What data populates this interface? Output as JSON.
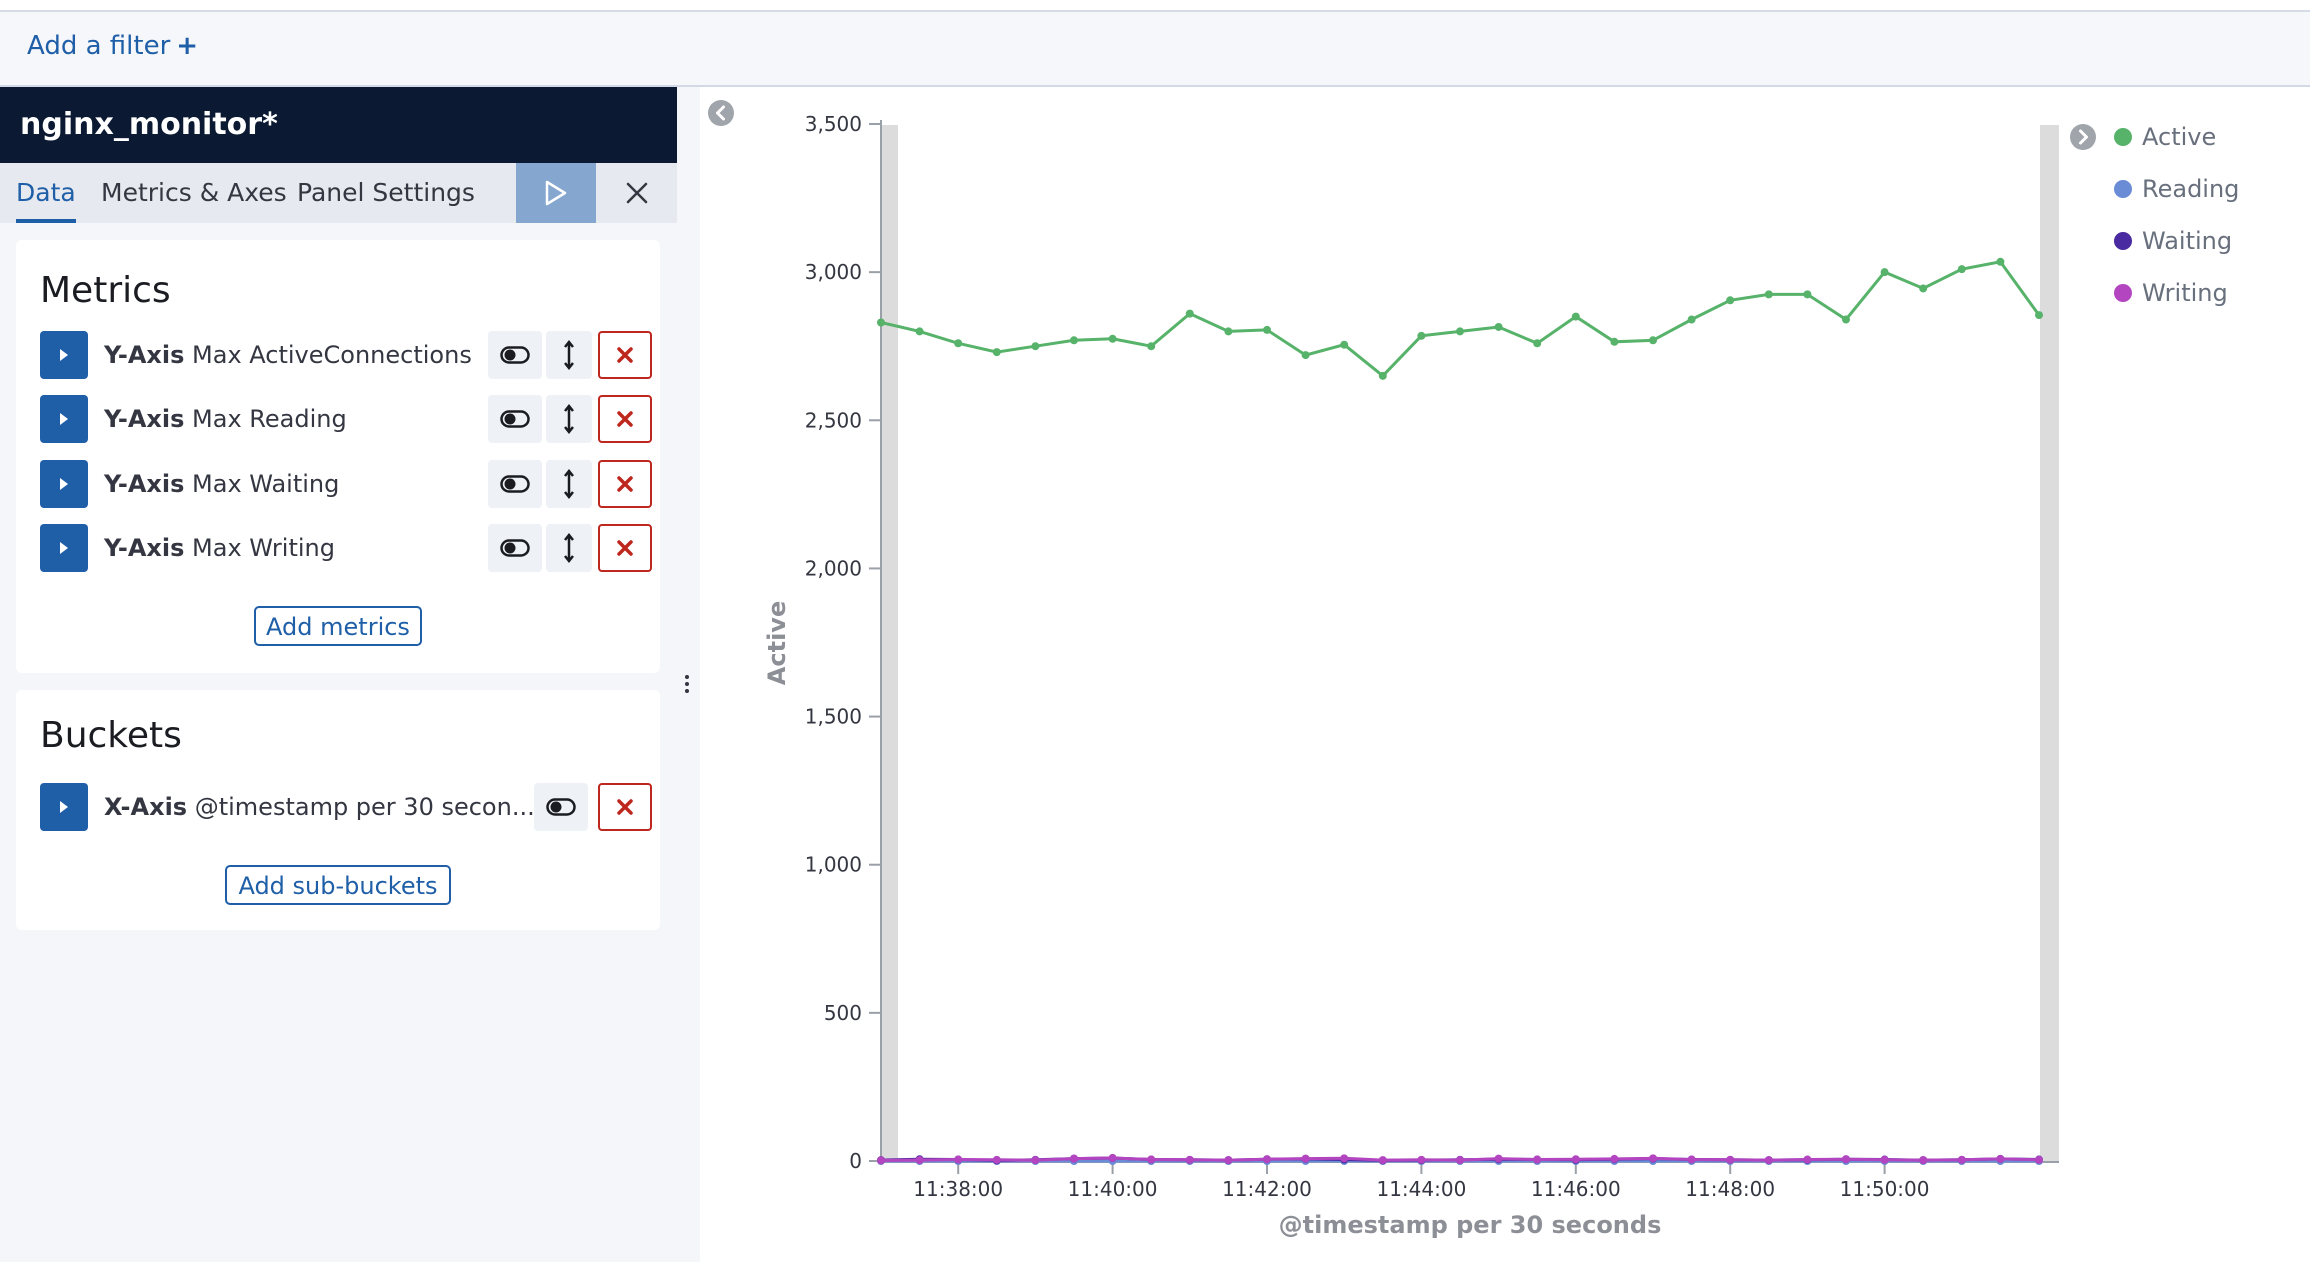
{
  "filter_bar": {
    "add_filter_label": "Add a filter",
    "plus_icon": "+"
  },
  "sidebar": {
    "title": "nginx_monitor*",
    "tabs": [
      {
        "label": "Data"
      },
      {
        "label": "Metrics & Axes"
      },
      {
        "label": "Panel Settings"
      }
    ],
    "metrics": {
      "heading": "Metrics",
      "items": [
        {
          "axis": "Y-Axis",
          "label": "Max ActiveConnections"
        },
        {
          "axis": "Y-Axis",
          "label": "Max Reading"
        },
        {
          "axis": "Y-Axis",
          "label": "Max Waiting"
        },
        {
          "axis": "Y-Axis",
          "label": "Max Writing"
        }
      ],
      "add_label": "Add metrics"
    },
    "buckets": {
      "heading": "Buckets",
      "items": [
        {
          "axis": "X-Axis",
          "label": "@timestamp per 30 secon..."
        }
      ],
      "add_label": "Add sub-buckets"
    }
  },
  "legend": [
    {
      "label": "Active",
      "color": "#57b26a"
    },
    {
      "label": "Reading",
      "color": "#6a8bd6"
    },
    {
      "label": "Waiting",
      "color": "#4a2aa0"
    },
    {
      "label": "Writing",
      "color": "#b346c0"
    }
  ],
  "chart_data": {
    "type": "line",
    "ylabel": "Active",
    "xlabel": "@timestamp per 30 seconds",
    "ylim": [
      0,
      3500
    ],
    "y_ticks": [
      "0",
      "500",
      "1,000",
      "1,500",
      "2,000",
      "2,500",
      "3,000",
      "3,500"
    ],
    "x_ticks": [
      "11:38:00",
      "11:40:00",
      "11:42:00",
      "11:44:00",
      "11:46:00",
      "11:48:00",
      "11:50:00"
    ],
    "x": [
      "11:37:00",
      "11:37:30",
      "11:38:00",
      "11:38:30",
      "11:39:00",
      "11:39:30",
      "11:40:00",
      "11:40:30",
      "11:41:00",
      "11:41:30",
      "11:42:00",
      "11:42:30",
      "11:43:00",
      "11:43:30",
      "11:44:00",
      "11:44:30",
      "11:45:00",
      "11:45:30",
      "11:46:00",
      "11:46:30",
      "11:47:00",
      "11:47:30",
      "11:48:00",
      "11:48:30",
      "11:49:00",
      "11:49:30",
      "11:50:00",
      "11:50:30",
      "11:51:00",
      "11:51:30",
      "11:52:00"
    ],
    "series": [
      {
        "name": "Active",
        "color": "#57b26a",
        "values": [
          2830,
          2800,
          2760,
          2730,
          2750,
          2770,
          2775,
          2750,
          2860,
          2800,
          2805,
          2720,
          2755,
          2650,
          2785,
          2800,
          2815,
          2760,
          2850,
          2765,
          2770,
          2840,
          2905,
          2925,
          2925,
          2840,
          3000,
          2945,
          3010,
          3035,
          2855
        ]
      },
      {
        "name": "Reading",
        "color": "#6a8bd6",
        "values": [
          0,
          0,
          0,
          0,
          0,
          0,
          0,
          0,
          0,
          0,
          0,
          0,
          0,
          0,
          0,
          0,
          0,
          0,
          0,
          0,
          0,
          0,
          0,
          0,
          0,
          0,
          0,
          0,
          0,
          0,
          0
        ]
      },
      {
        "name": "Waiting",
        "color": "#4a2aa0",
        "values": [
          3,
          6,
          5,
          2,
          4,
          8,
          10,
          5,
          4,
          3,
          6,
          7,
          5,
          2,
          3,
          4,
          6,
          5,
          4,
          6,
          8,
          5,
          4,
          3,
          4,
          6,
          5,
          3,
          4,
          7,
          5
        ]
      },
      {
        "name": "Writing",
        "color": "#b346c0",
        "values": [
          2,
          3,
          5,
          4,
          3,
          8,
          10,
          5,
          4,
          3,
          6,
          8,
          9,
          3,
          4,
          3,
          8,
          5,
          6,
          7,
          9,
          5,
          4,
          3,
          5,
          6,
          4,
          3,
          4,
          7,
          4
        ]
      }
    ]
  }
}
